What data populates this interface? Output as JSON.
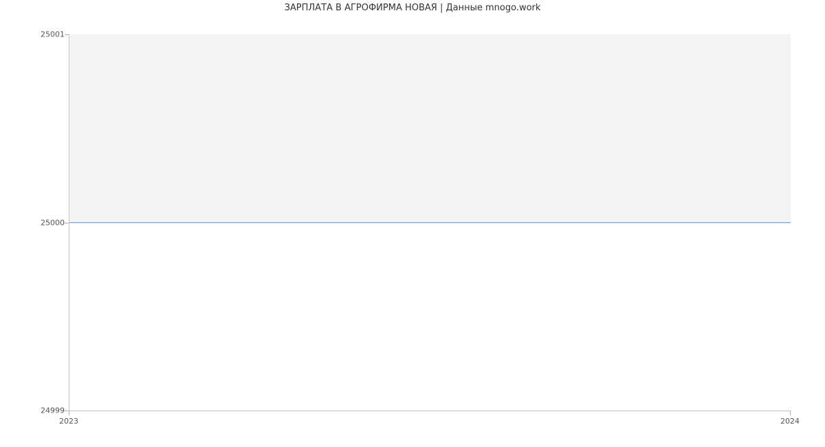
{
  "chart_data": {
    "type": "line",
    "title": "ЗАРПЛАТА В АГРОФИРМА НОВАЯ | Данные mnogo.work",
    "xlabel": "",
    "ylabel": "",
    "x": [
      "2023",
      "2024"
    ],
    "values": [
      25000,
      25000
    ],
    "y_ticks": [
      24999,
      25000,
      25001
    ],
    "ylim": [
      24999,
      25001
    ],
    "series_color": "#4f8fd6",
    "area_fill_color": "#f4f4f4"
  },
  "axes": {
    "y_tick_labels": {
      "top": "25001",
      "mid": "25000",
      "bot": "24999"
    },
    "x_tick_labels": {
      "left": "2023",
      "right": "2024"
    }
  },
  "title_text": "ЗАРПЛАТА В АГРОФИРМА НОВАЯ | Данные mnogo.work"
}
